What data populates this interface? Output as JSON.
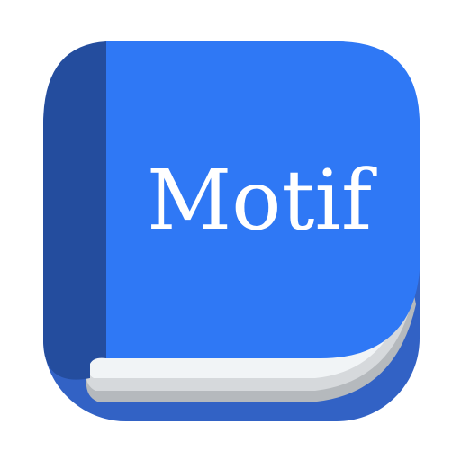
{
  "app_icon": {
    "title": "Motif",
    "icon_name": "book-icon",
    "colors": {
      "background": "#ffffff",
      "cover": "#2f78f5",
      "spine": "#244d9e",
      "back_cover": "#3262c5",
      "pages_light": "#f1f4f6",
      "pages_mid": "#d6d9dc",
      "pages_dark": "#b5b9bd",
      "title": "#ffffff"
    }
  }
}
